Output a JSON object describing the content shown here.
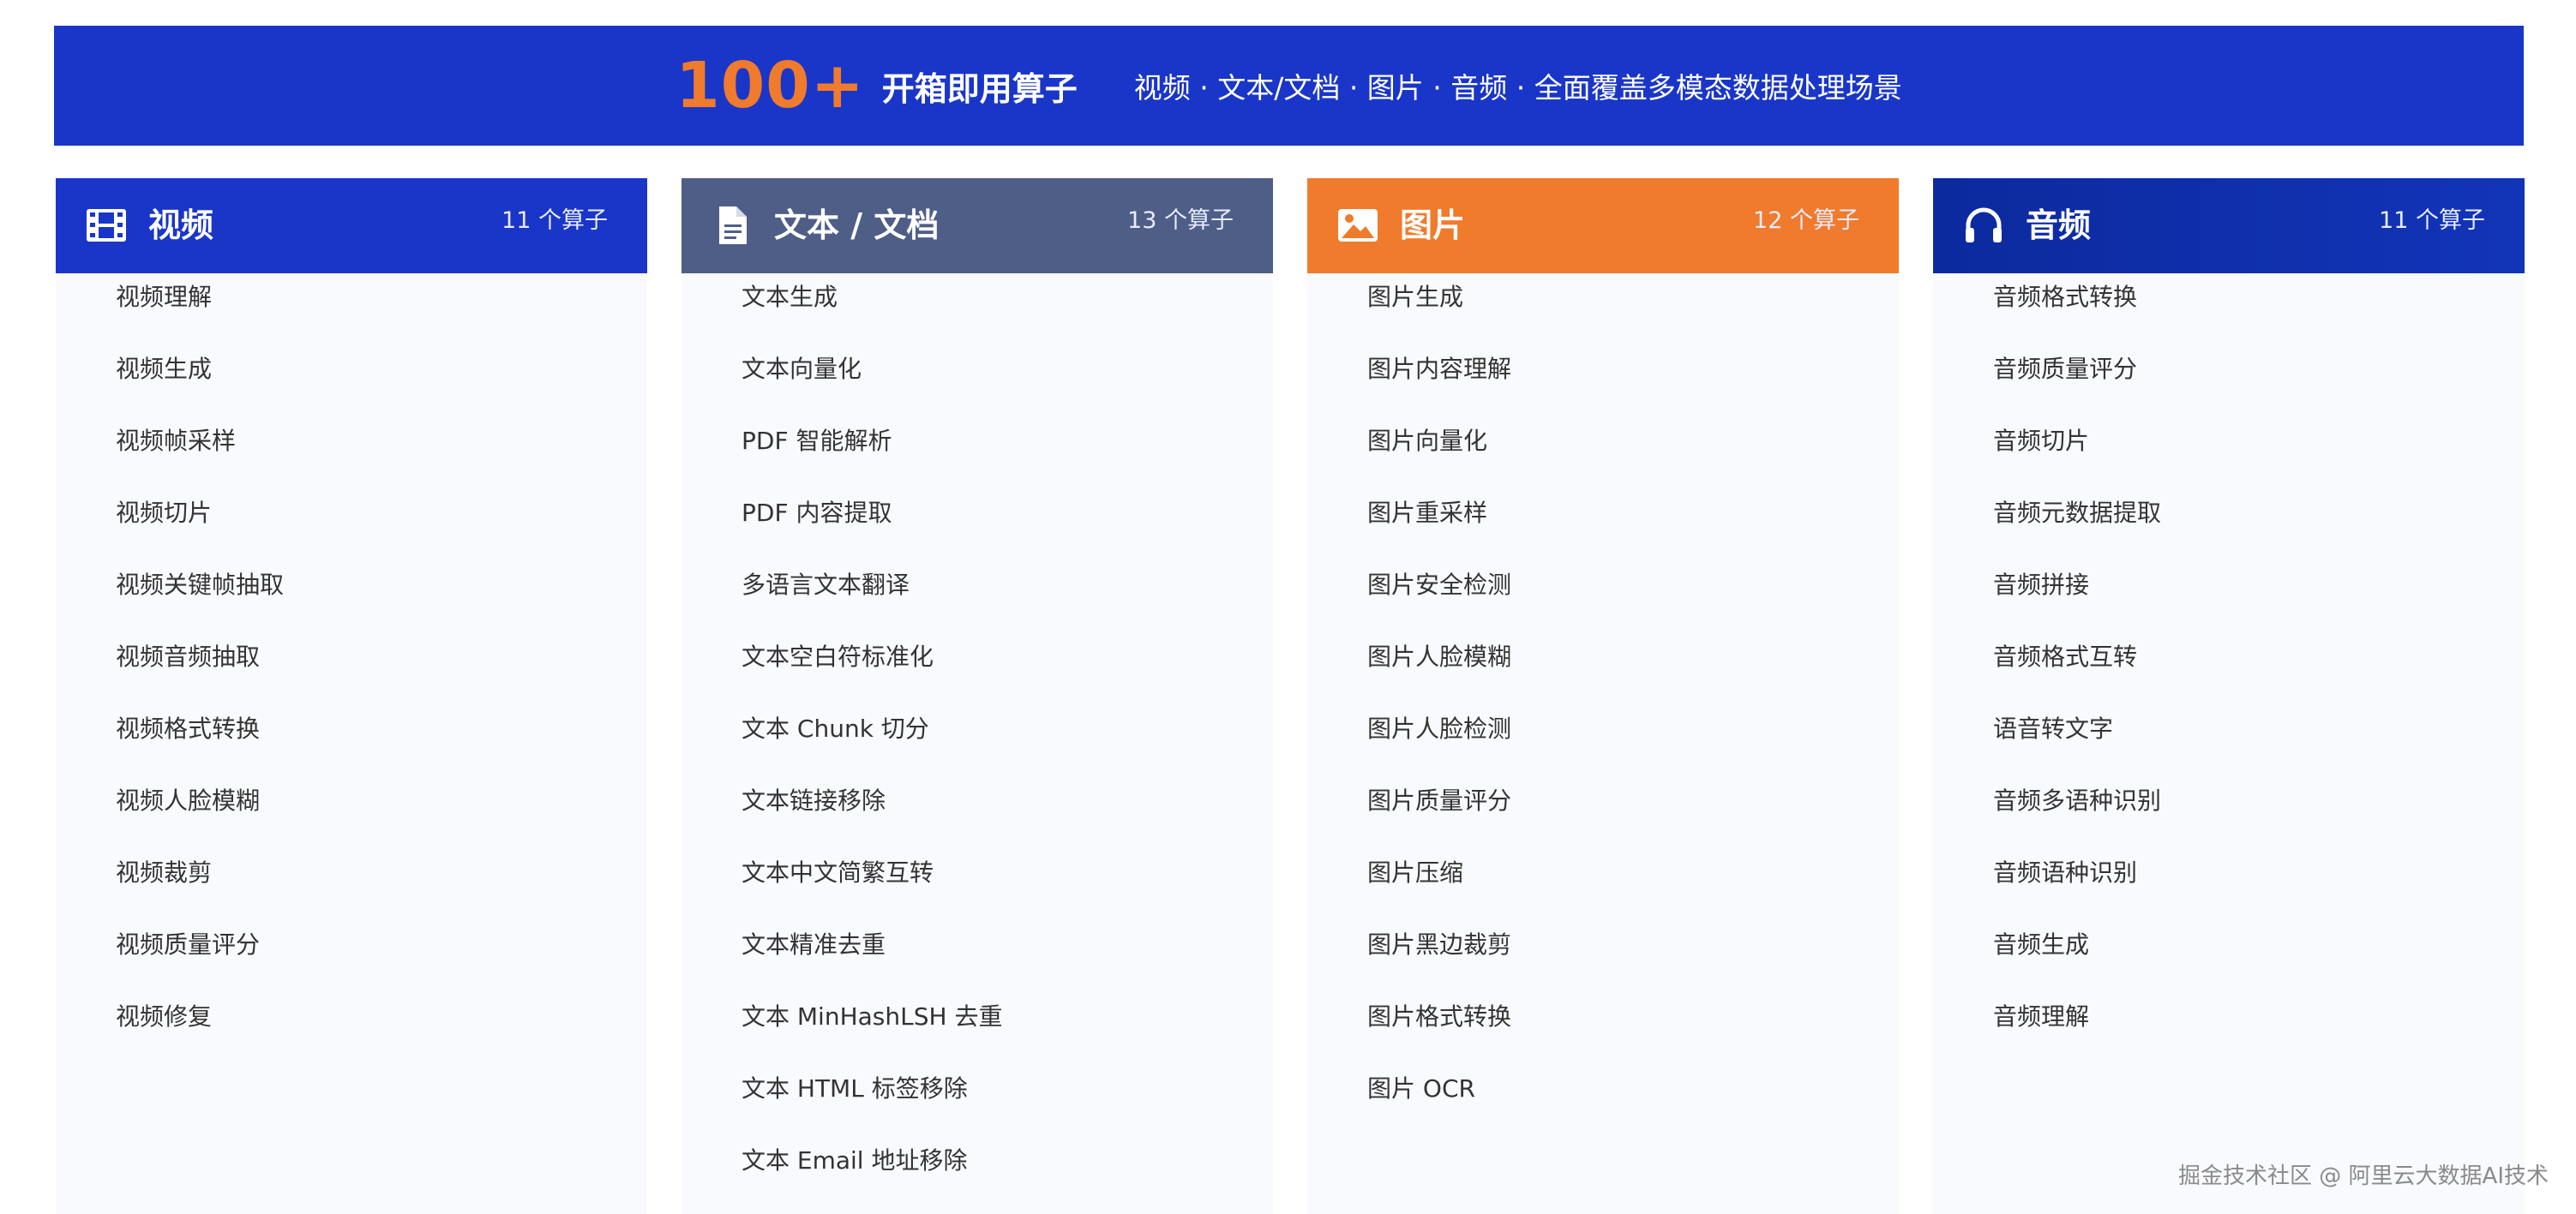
{
  "banner": {
    "number": "100+",
    "title": "开箱即用算子",
    "subtitle": "视频 · 文本/文档 · 图片 · 音频 · 全面覆盖多模态数据处理场景"
  },
  "colors": {
    "banner_bg": "#1a36c8",
    "accent_orange": "#f07b2c",
    "video_header": "#1a36c8",
    "text_header": "#4f5e87",
    "image_header": "#f07b2c",
    "audio_header": "#0c2a9e"
  },
  "columns": [
    {
      "title": "视频",
      "count": "11 个算子",
      "icon": "film-icon",
      "items": [
        "视频理解",
        "视频生成",
        "视频帧采样",
        "视频切片",
        "视频关键帧抽取",
        "视频音频抽取",
        "视频格式转换",
        "视频人脸模糊",
        "视频裁剪",
        "视频质量评分",
        "视频修复"
      ]
    },
    {
      "title": "文本 / 文档",
      "count": "13 个算子",
      "icon": "document-icon",
      "items": [
        "文本生成",
        "文本向量化",
        "PDF 智能解析",
        "PDF 内容提取",
        "多语言文本翻译",
        "文本空白符标准化",
        "文本 Chunk 切分",
        "文本链接移除",
        "文本中文简繁互转",
        "文本精准去重",
        "文本 MinHashLSH 去重",
        "文本 HTML 标签移除",
        "文本 Email 地址移除"
      ]
    },
    {
      "title": "图片",
      "count": "12 个算子",
      "icon": "image-icon",
      "items": [
        "图片生成",
        "图片内容理解",
        "图片向量化",
        "图片重采样",
        "图片安全检测",
        "图片人脸模糊",
        "图片人脸检测",
        "图片质量评分",
        "图片压缩",
        "图片黑边裁剪",
        "图片格式转换",
        "图片 OCR"
      ]
    },
    {
      "title": "音频",
      "count": "11 个算子",
      "icon": "headphones-icon",
      "items": [
        "音频格式转换",
        "音频质量评分",
        "音频切片",
        "音频元数据提取",
        "音频拼接",
        "音频格式互转",
        "语音转文字",
        "音频多语种识别",
        "音频语种识别",
        "音频生成",
        "音频理解"
      ]
    }
  ],
  "watermark": "掘金技术社区 @ 阿里云大数据AI技术"
}
